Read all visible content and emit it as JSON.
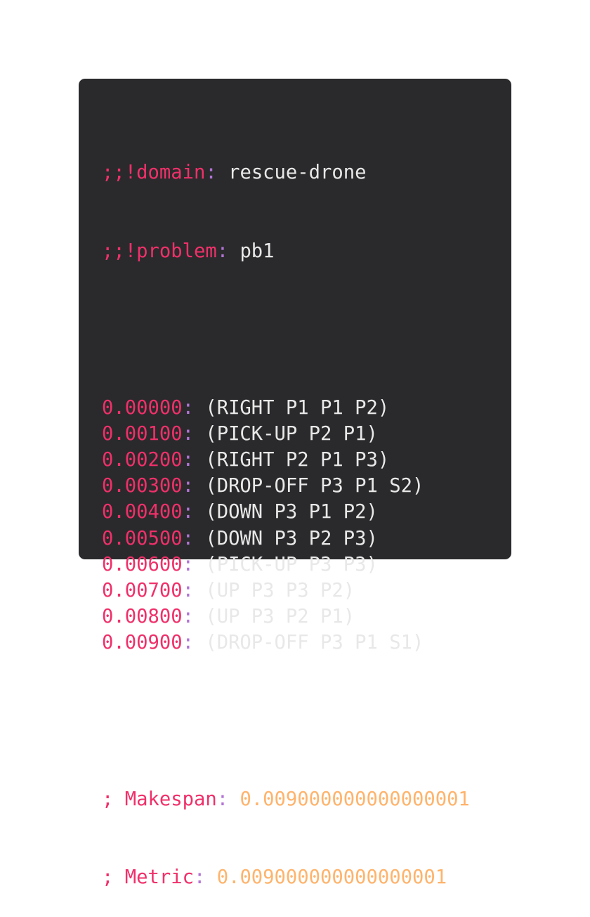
{
  "header": {
    "domain_key": ";;!domain",
    "domain_value": "rescue-drone",
    "problem_key": ";;!problem",
    "problem_value": "pb1"
  },
  "separator": ":",
  "plan": [
    {
      "time": "0.00000",
      "action": "(RIGHT P1 P1 P2)"
    },
    {
      "time": "0.00100",
      "action": "(PICK-UP P2 P1)"
    },
    {
      "time": "0.00200",
      "action": "(RIGHT P2 P1 P3)"
    },
    {
      "time": "0.00300",
      "action": "(DROP-OFF P3 P1 S2)"
    },
    {
      "time": "0.00400",
      "action": "(DOWN P3 P1 P2)"
    },
    {
      "time": "0.00500",
      "action": "(DOWN P3 P2 P3)"
    },
    {
      "time": "0.00600",
      "action": "(PICK-UP P3 P3)"
    },
    {
      "time": "0.00700",
      "action": "(UP P3 P3 P2)"
    },
    {
      "time": "0.00800",
      "action": "(UP P3 P2 P1)"
    },
    {
      "time": "0.00900",
      "action": "(DROP-OFF P3 P1 S1)"
    }
  ],
  "footer": {
    "makespan_key": "; Makespan",
    "makespan_value": "0.009000000000000001",
    "metric_key": "; Metric",
    "metric_value": "0.009000000000000001"
  },
  "colors": {
    "background": "#2a2a2c",
    "keyword": "#f0306a",
    "punctuation": "#b273d6",
    "text": "#e8e8e8",
    "number": "#ffb36b"
  }
}
